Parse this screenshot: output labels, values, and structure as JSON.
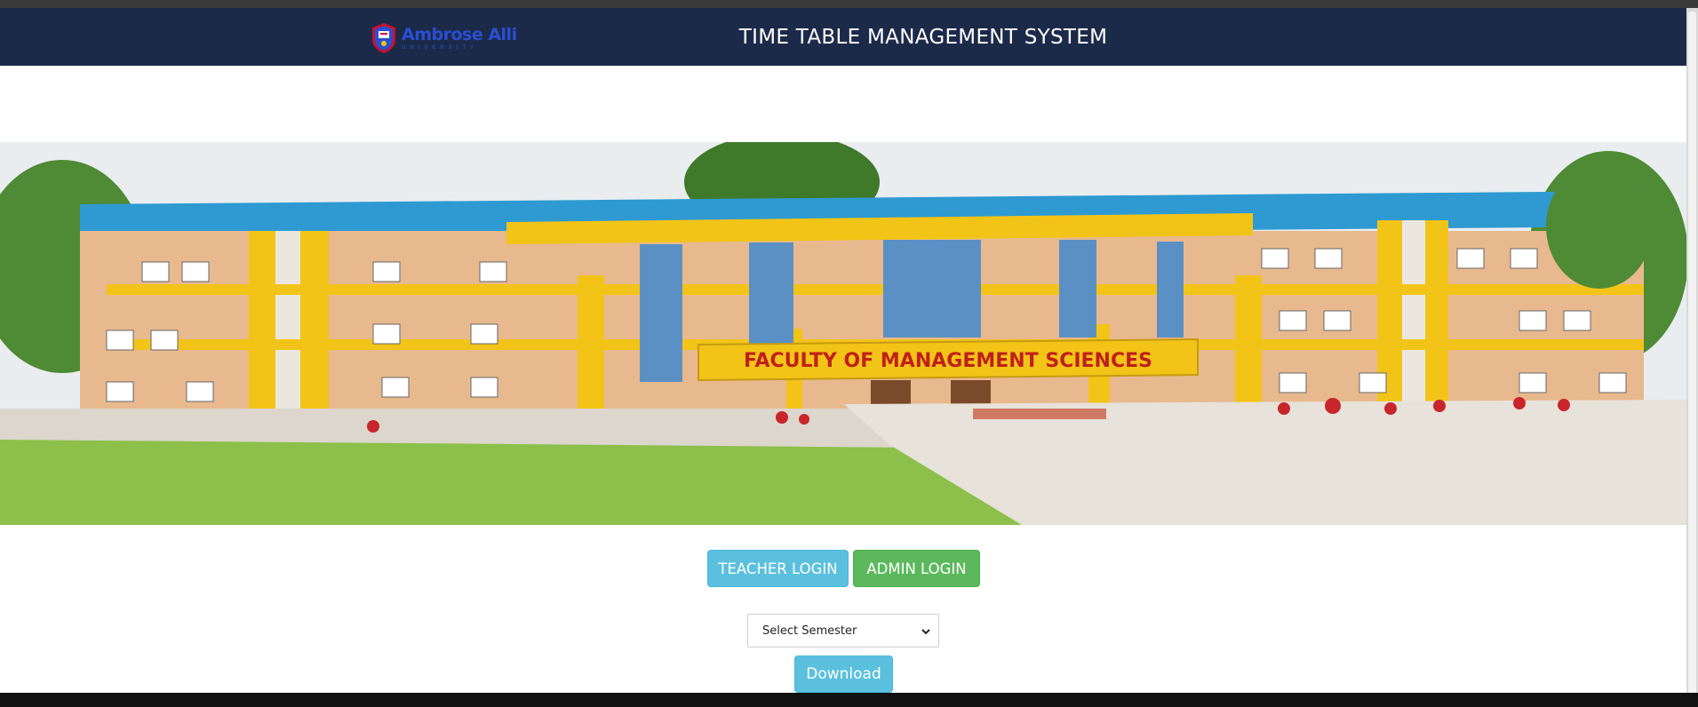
{
  "header": {
    "logo_name": "Ambrose Alli",
    "logo_sub": "UNIVERSITY",
    "title": "TIME TABLE MANAGEMENT SYSTEM"
  },
  "banner": {
    "sign_text": "FACULTY OF MANAGEMENT SCIENCES"
  },
  "actions": {
    "teacher_login": "TEACHER LOGIN",
    "admin_login": "ADMIN LOGIN",
    "semester_select": "Select Semester",
    "download": "Download"
  },
  "colors": {
    "navbar": "#1c2a4a",
    "info": "#5bc0de",
    "success": "#5cb85c"
  }
}
